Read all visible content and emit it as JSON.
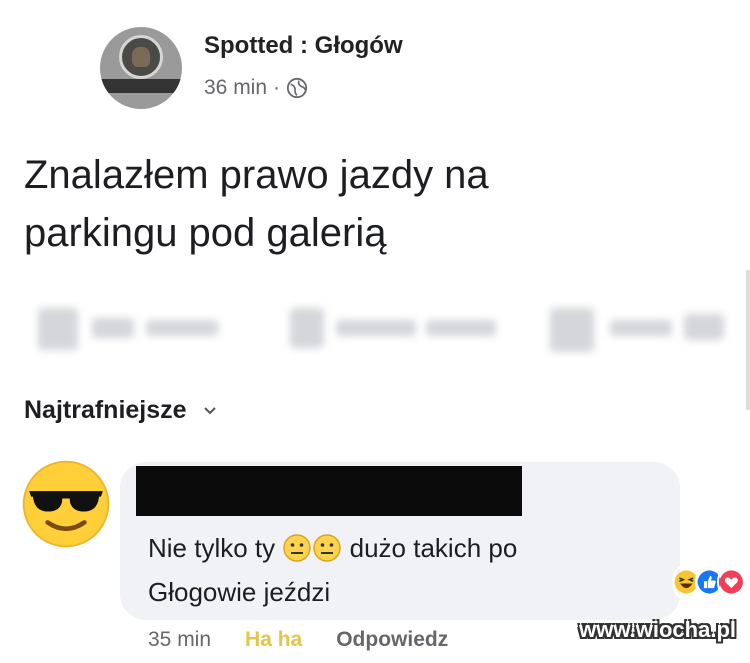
{
  "post": {
    "page_name": "Spotted : Głogów",
    "time": "36 min",
    "separator": "·",
    "text_line1": "Znalazłem prawo jazdy na",
    "text_line2": "parkingu pod galerią"
  },
  "comments_sort": {
    "label": "Najtrafniejsze"
  },
  "comment": {
    "text_part1": "Nie tylko ty",
    "text_part2": "dużo takich po",
    "text_line2": "Głogowie jeździ",
    "time": "35 min",
    "reaction_label": "Ha ha",
    "reply_label": "Odpowiedz",
    "reactions": [
      "haha",
      "like",
      "love"
    ]
  },
  "watermark": "www.wiocha.pl",
  "icons": {
    "globe": "globe-icon",
    "chevron": "chevron-down-icon",
    "commenter_avatar": "sunglasses-emoji-icon",
    "inline_emoji": "neutral-face-emoji-icon"
  },
  "colors": {
    "bubble": "#f0f2f5",
    "secondary_text": "#65676b",
    "haha": "#e5c547",
    "like": "#1877f2",
    "love": "#f33e58"
  }
}
